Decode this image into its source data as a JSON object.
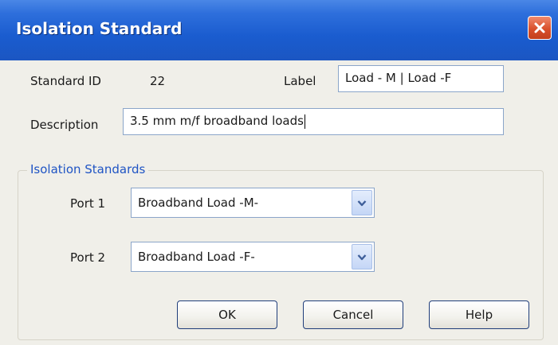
{
  "window": {
    "title": "Isolation Standard"
  },
  "fields": {
    "standard_id_label": "Standard ID",
    "standard_id_value": "22",
    "label_label": "Label",
    "label_value": "Load - M | Load -F",
    "description_label": "Description",
    "description_value": "3.5 mm m/f broadband loads"
  },
  "group": {
    "title": "Isolation Standards",
    "ports": [
      {
        "label": "Port 1",
        "selected": "Broadband Load -M-"
      },
      {
        "label": "Port 2",
        "selected": "Broadband Load -F-"
      }
    ]
  },
  "buttons": {
    "ok": "OK",
    "cancel": "Cancel",
    "help": "Help"
  },
  "colors": {
    "title_bar": "#1b5bcc",
    "close_button": "#d9502c",
    "group_title": "#1f54c4",
    "dialog_bg": "#f0efe9"
  },
  "icons": {
    "close": "close-icon",
    "dropdown": "chevron-down-icon"
  }
}
